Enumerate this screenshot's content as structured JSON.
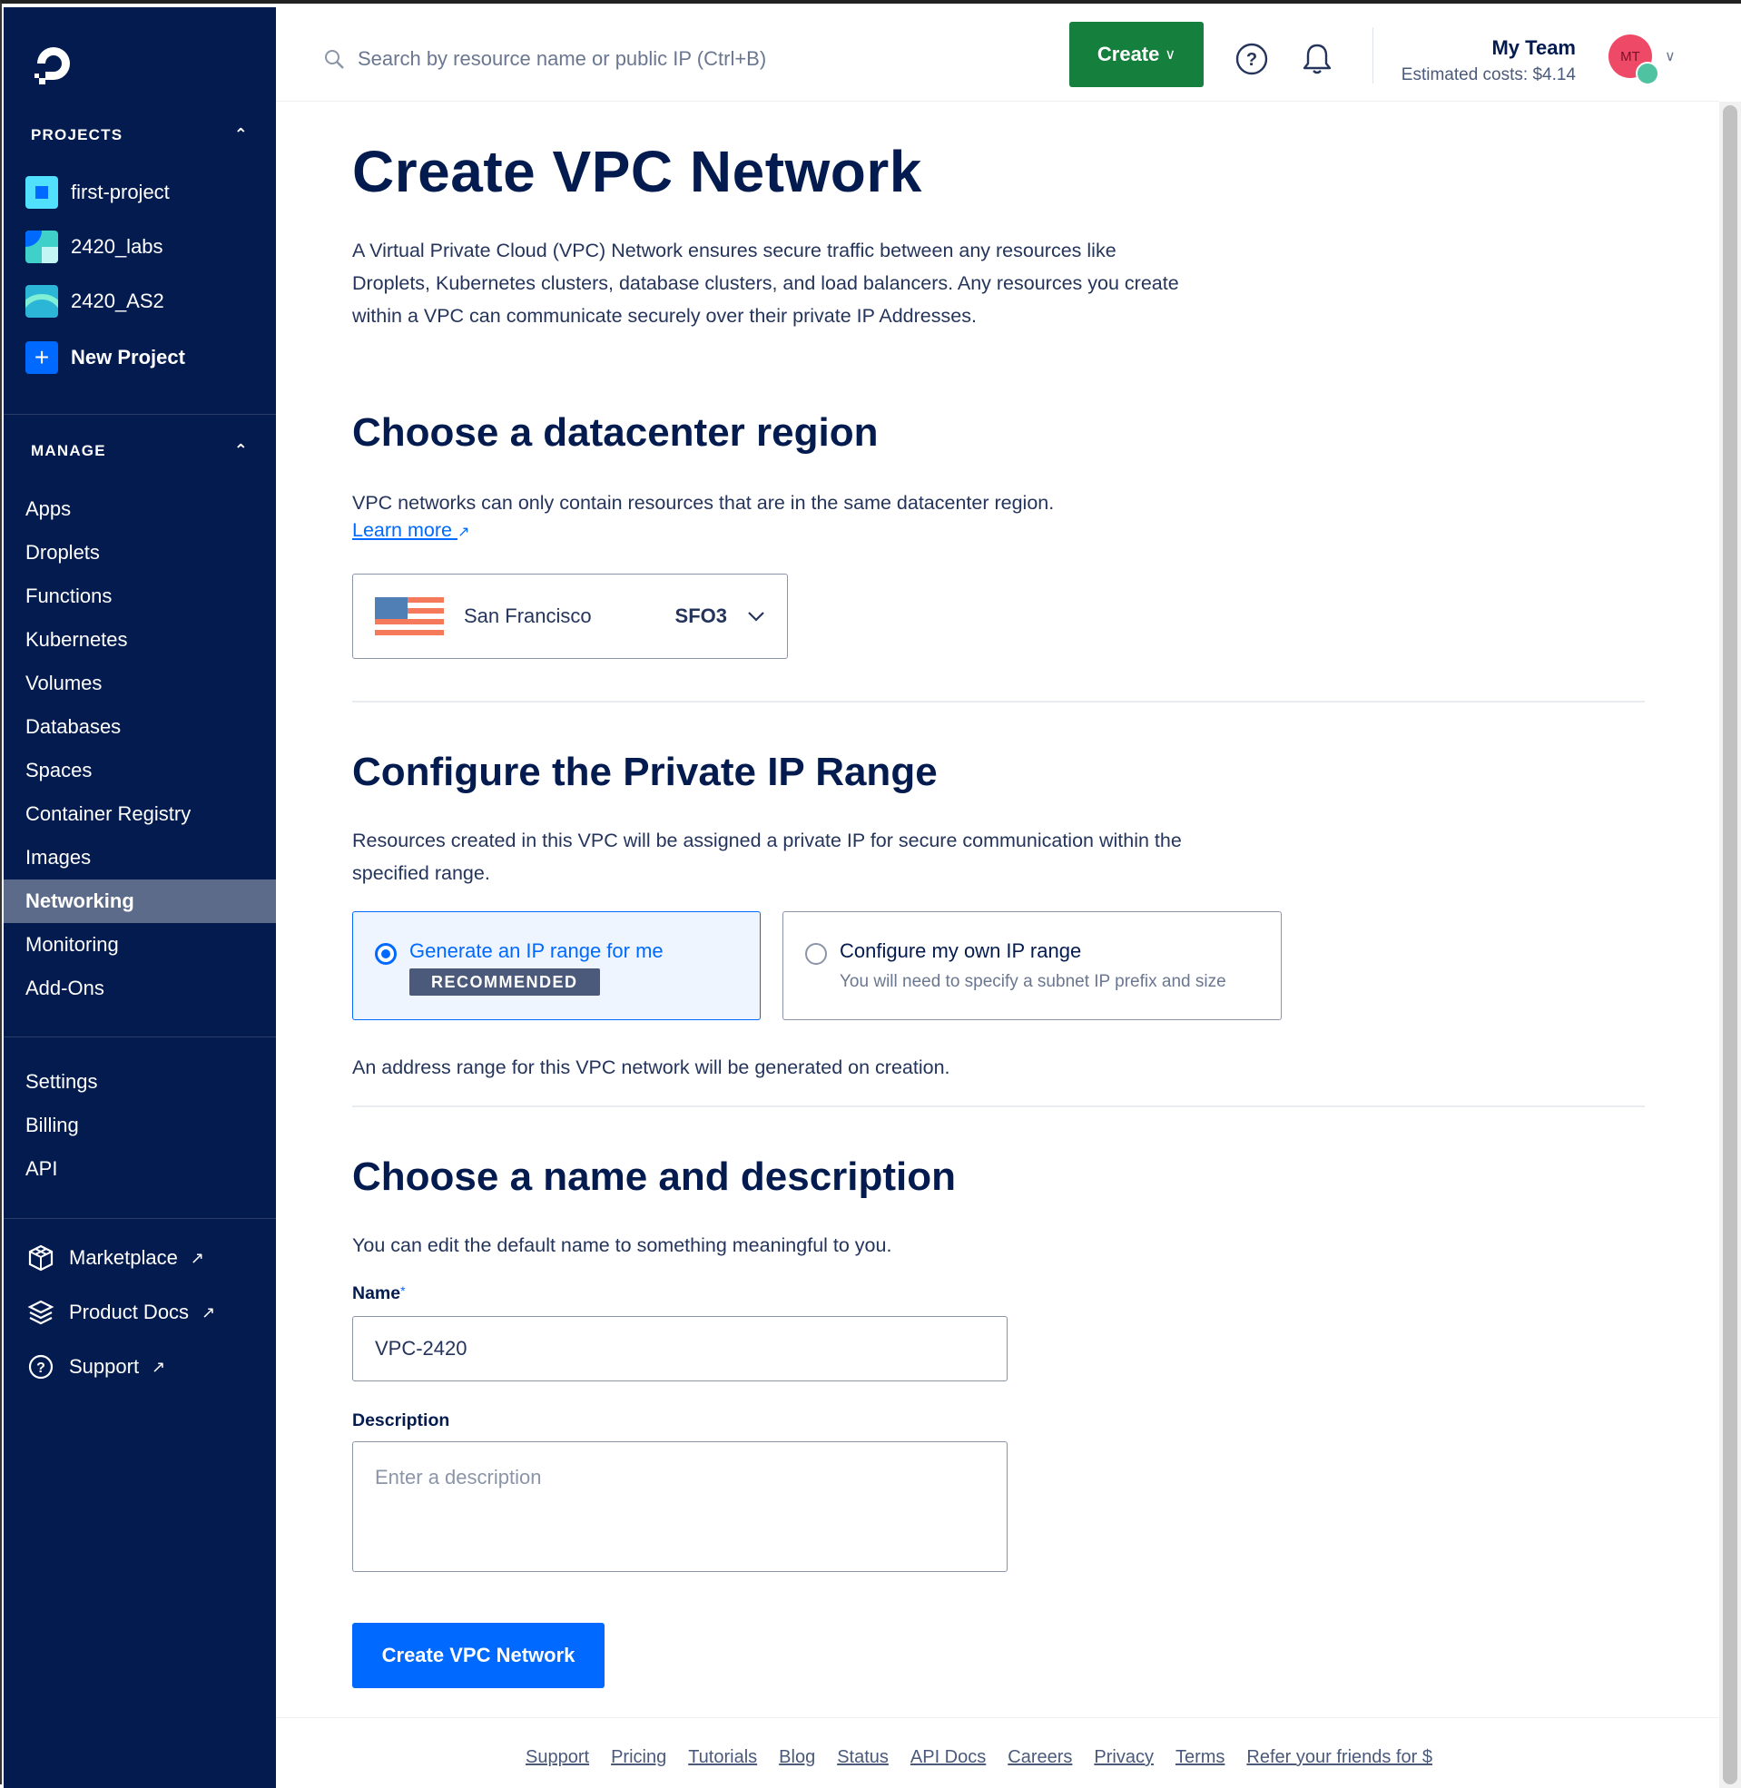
{
  "sidebar": {
    "projects_heading": "PROJECTS",
    "projects": [
      {
        "name": "first-project",
        "color": "#52e0ff"
      },
      {
        "name": "2420_labs",
        "color": "#3fd0c9"
      },
      {
        "name": "2420_AS2",
        "color": "#2bb5d6"
      }
    ],
    "new_project": "New Project",
    "manage_heading": "MANAGE",
    "manage_items": [
      "Apps",
      "Droplets",
      "Functions",
      "Kubernetes",
      "Volumes",
      "Databases",
      "Spaces",
      "Container Registry",
      "Images",
      "Networking",
      "Monitoring",
      "Add-Ons"
    ],
    "active_item": "Networking",
    "account_items": [
      "Settings",
      "Billing",
      "API"
    ],
    "external_items": [
      {
        "label": "Marketplace",
        "icon": "cube-icon"
      },
      {
        "label": "Product Docs",
        "icon": "layers-icon"
      },
      {
        "label": "Support",
        "icon": "help-circle-icon"
      }
    ]
  },
  "topbar": {
    "search_placeholder": "Search by resource name or public IP (Ctrl+B)",
    "create_label": "Create",
    "team_name": "My Team",
    "estimated_costs": "Estimated costs: $4.14",
    "avatar_initials": "MT"
  },
  "main": {
    "title": "Create VPC Network",
    "intro": "A Virtual Private Cloud (VPC) Network ensures secure traffic between any resources like Droplets, Kubernetes clusters, database clusters, and load balancers. Any resources you create within a VPC can communicate securely over their private IP Addresses.",
    "region": {
      "heading": "Choose a datacenter region",
      "text": "VPC networks can only contain resources that are in the same datacenter region.",
      "learn_more": "Learn more",
      "selected_name": "San Francisco",
      "selected_code": "SFO3"
    },
    "ip_range": {
      "heading": "Configure the Private IP Range",
      "text": "Resources created in this VPC will be assigned a private IP for secure communication within the specified range.",
      "option_generate": "Generate an IP range for me",
      "recommended": "RECOMMENDED",
      "option_custom": "Configure my own IP range",
      "option_custom_sub": "You will need to specify a subnet IP prefix and size",
      "note": "An address range for this VPC network will be generated on creation."
    },
    "name_desc": {
      "heading": "Choose a name and description",
      "text": "You can edit the default name to something meaningful to you.",
      "name_label": "Name",
      "name_value": "VPC-2420",
      "description_label": "Description",
      "description_placeholder": "Enter a description"
    },
    "submit": "Create VPC Network"
  },
  "footer": {
    "links": [
      "Support",
      "Pricing",
      "Tutorials",
      "Blog",
      "Status",
      "API Docs",
      "Careers",
      "Privacy",
      "Terms",
      "Refer your friends for $"
    ]
  },
  "colors": {
    "sidebar_bg": "#031b4e",
    "primary": "#0069ff",
    "create_green": "#15803d"
  }
}
